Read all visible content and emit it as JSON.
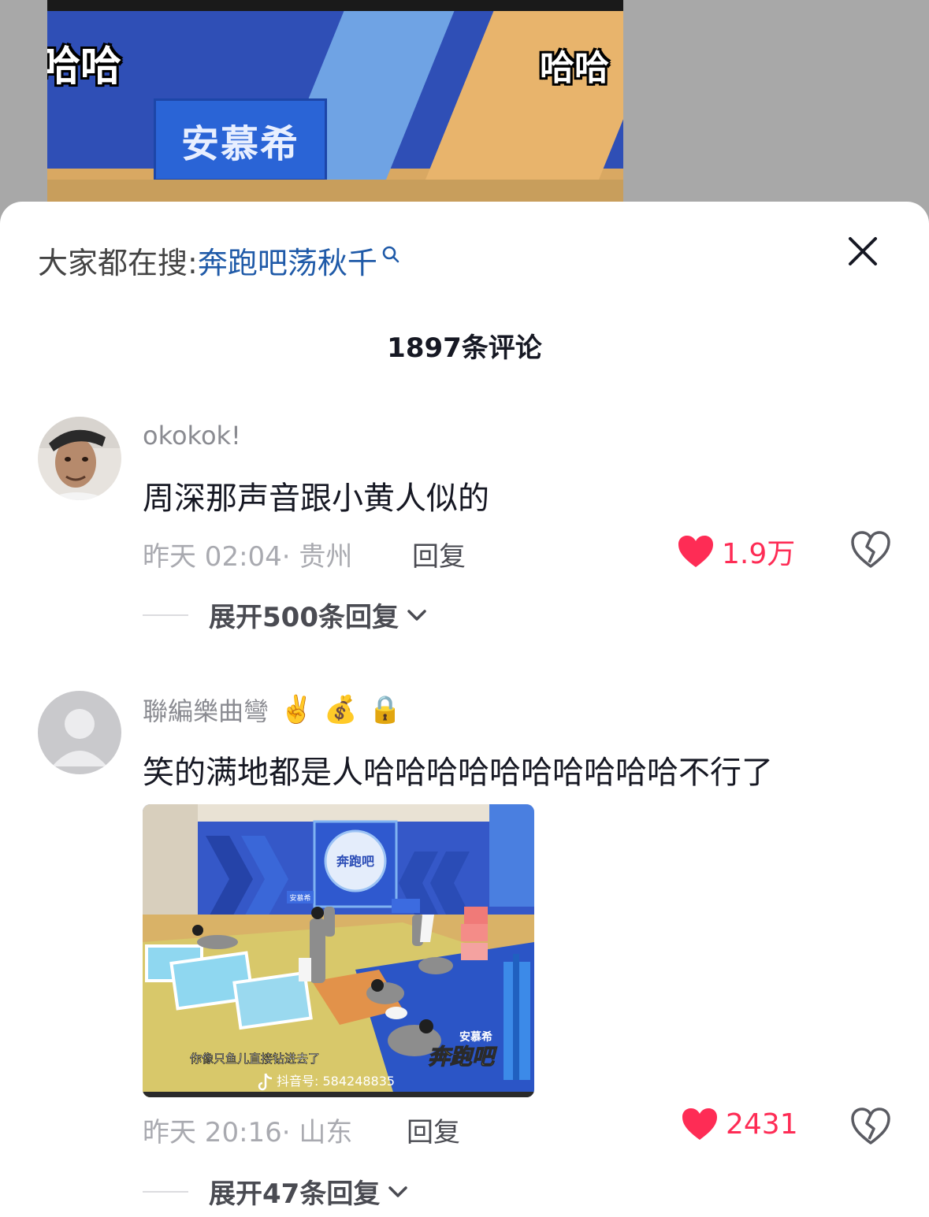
{
  "video": {
    "caption_left": "哈哈",
    "caption_right": "哈哈",
    "board_text": "安慕希"
  },
  "search": {
    "prefix": "大家都在搜:",
    "term": "奔跑吧荡秋千"
  },
  "comments_header": {
    "count_title": "1897条评论"
  },
  "comments": [
    {
      "username": "okokok!",
      "text": "周深那声音跟小黄人似的",
      "time_location": "昨天 02:04· 贵州",
      "reply_label": "回复",
      "like_count": "1.9万",
      "expand_label": "展开500条回复"
    },
    {
      "username": "聯編樂曲彎",
      "emojis": [
        "✌️",
        "💰",
        "🔒"
      ],
      "text": "笑的满地都是人哈哈哈哈哈哈哈哈哈哈不行了",
      "image": {
        "sponsor_small": "安慕希",
        "subtitle": "你像只鱼儿直接钻进去了",
        "watermark": "抖音号: 584248835",
        "show_logo": "奔跑吧"
      },
      "time_location": "昨天 20:16· 山东",
      "reply_label": "回复",
      "like_count": "2431",
      "expand_label": "展开47条回复"
    }
  ],
  "colors": {
    "accent_like": "#fe2c55",
    "search_term": "#1f5aa8",
    "backdrop": "#a8a8a8"
  }
}
